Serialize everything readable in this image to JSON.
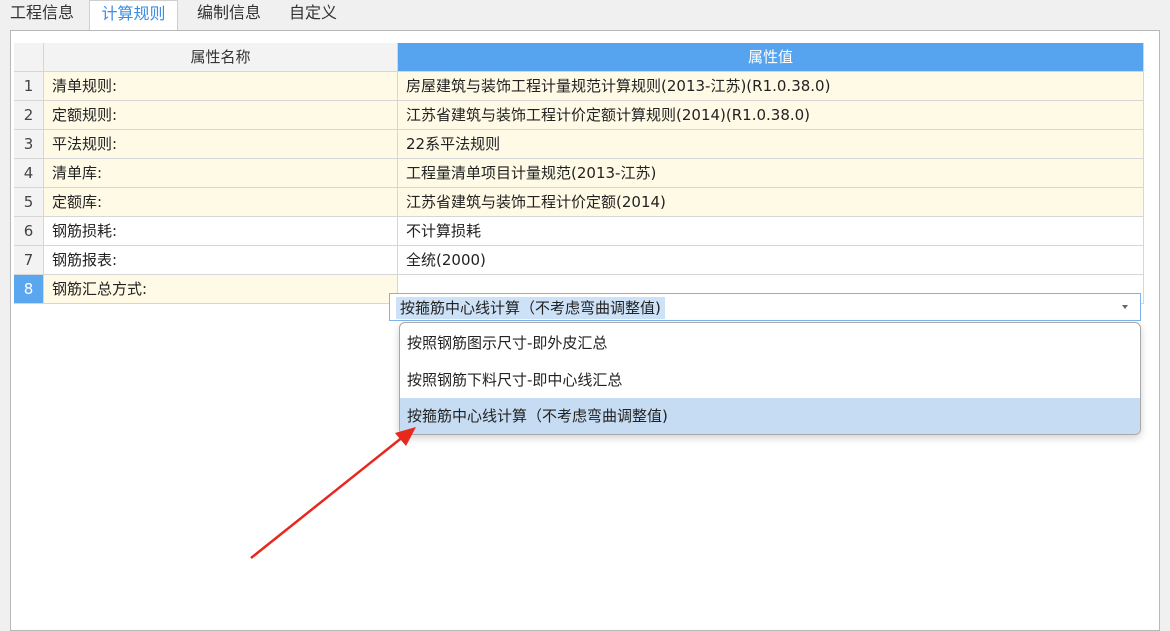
{
  "tabs": [
    "工程信息",
    "计算规则",
    "编制信息",
    "自定义"
  ],
  "active_tab": "计算规则",
  "table": {
    "header": {
      "num": "",
      "name": "属性名称",
      "value": "属性值"
    },
    "rows": [
      {
        "num": "1",
        "name": "清单规则:",
        "value": "房屋建筑与装饰工程计量规范计算规则(2013-江苏)(R1.0.38.0)"
      },
      {
        "num": "2",
        "name": "定额规则:",
        "value": "江苏省建筑与装饰工程计价定额计算规则(2014)(R1.0.38.0)"
      },
      {
        "num": "3",
        "name": "平法规则:",
        "value": "22系平法规则"
      },
      {
        "num": "4",
        "name": "清单库:",
        "value": "工程量清单项目计量规范(2013-江苏)"
      },
      {
        "num": "5",
        "name": "定额库:",
        "value": "江苏省建筑与装饰工程计价定额(2014)"
      },
      {
        "num": "6",
        "name": "钢筋损耗:",
        "value": "不计算损耗"
      },
      {
        "num": "7",
        "name": "钢筋报表:",
        "value": "全统(2000)"
      },
      {
        "num": "8",
        "name": "钢筋汇总方式:",
        "value": "按箍筋中心线计算（不考虑弯曲调整值)"
      }
    ]
  },
  "dropdown": {
    "current": "按箍筋中心线计算（不考虑弯曲调整值)",
    "options": [
      "按照钢筋图示尺寸-即外皮汇总",
      "按照钢筋下料尺寸-即中心线汇总",
      "按箍筋中心线计算（不考虑弯曲调整值)"
    ],
    "selected_index": 2
  },
  "annotation": {
    "color": "#e8281c",
    "icon": "red-arrow"
  }
}
